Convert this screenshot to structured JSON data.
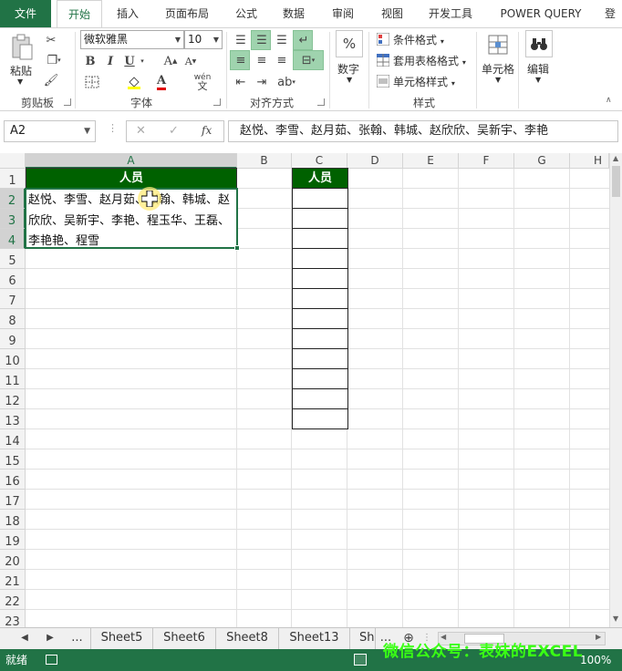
{
  "ribbon_tabs": [
    {
      "label": "文件"
    },
    {
      "label": "开始"
    },
    {
      "label": "插入"
    },
    {
      "label": "页面布局"
    },
    {
      "label": "公式"
    },
    {
      "label": "数据"
    },
    {
      "label": "审阅"
    },
    {
      "label": "视图"
    },
    {
      "label": "开发工具"
    },
    {
      "label": "POWER QUERY"
    },
    {
      "label": "登"
    }
  ],
  "ribbon": {
    "clipboard": {
      "paste_label": "粘贴",
      "group_label": "剪贴板"
    },
    "font": {
      "font_name": "微软雅黑",
      "font_size": "10",
      "bold": "B",
      "italic": "I",
      "underline": "U",
      "grow_font": "A",
      "shrink_font": "A",
      "font_color_glyph": "A",
      "phonetic": "wén",
      "group_label": "字体"
    },
    "alignment": {
      "group_label": "对齐方式"
    },
    "number": {
      "label": "数字",
      "percent": "%"
    },
    "styles": {
      "conditional": "条件格式",
      "table_format": "套用表格格式",
      "cell_style": "单元格样式",
      "group_label": "样式"
    },
    "cells": {
      "label": "单元格"
    },
    "editing": {
      "label": "编辑"
    }
  },
  "formula_bar": {
    "name_box": "A2",
    "cancel": "✕",
    "enter": "✓",
    "fx": "fx",
    "formula": "赵悦、李雪、赵月茹、张翰、韩城、赵欣欣、吴新宇、李艳"
  },
  "grid": {
    "columns": [
      "A",
      "B",
      "C",
      "D",
      "E",
      "F",
      "G",
      "H"
    ],
    "rows": [
      "1",
      "2",
      "3",
      "4",
      "5",
      "6",
      "7",
      "8",
      "9",
      "10",
      "11",
      "12",
      "13",
      "14",
      "15",
      "16",
      "17",
      "18",
      "19",
      "20",
      "21",
      "22",
      "23"
    ],
    "a1_header": "人员",
    "c1_header": "人员",
    "a2_lines": [
      "赵悦、李雪、赵月茹、张翰、韩城、赵",
      "欣欣、吴新宇、李艳、程玉华、王磊、",
      "李艳艳、程雪"
    ]
  },
  "sheet_tabs": {
    "ellipsis": "...",
    "tabs": [
      "Sheet5",
      "Sheet6",
      "Sheet8",
      "Sheet13",
      "Sh"
    ],
    "more": "..."
  },
  "status_bar": {
    "ready": "就绪",
    "zoom": "100%"
  },
  "watermark": "微信公众号：表妹的EXCEL",
  "colors": {
    "excel_green": "#217346",
    "header_fill": "#006100",
    "watermark": "#39ff14"
  }
}
